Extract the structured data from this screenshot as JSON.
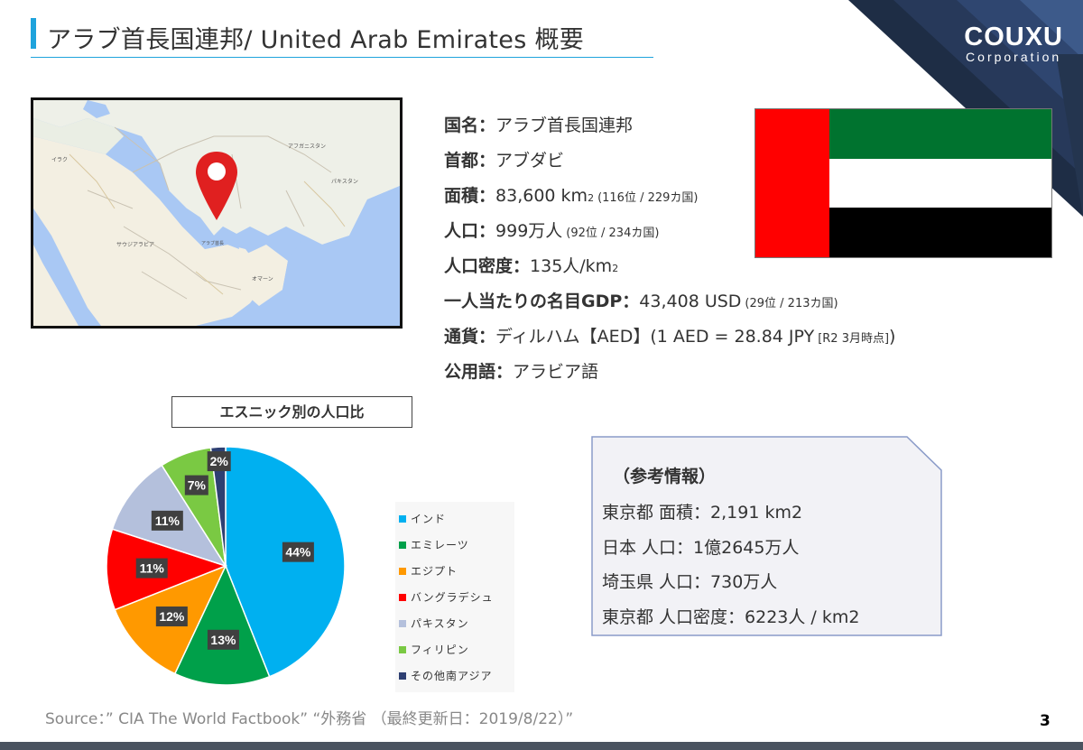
{
  "header": {
    "title": "アラブ首長国連邦/ United Arab Emirates 概要"
  },
  "logo": {
    "name": "COUXU",
    "sub": "Corporation"
  },
  "colors": {
    "accent": "#1fa3dc",
    "corner_dark": "#1e2d45"
  },
  "map": {
    "labels": [
      "アフガニスタン",
      "イラク",
      "パキスタン",
      "サウジアラビア",
      "アラブ首長国連邦",
      "オマーン"
    ],
    "marker_icon": "map-pin-icon"
  },
  "info": {
    "name_label": "国名：",
    "name_value": "アラブ首長国連邦",
    "capital_label": "首都：",
    "capital_value": "アブダビ",
    "area_label": "面積：",
    "area_value": " 83,600 km",
    "area_sup": "2",
    "area_rank": "(116位 / 229カ国)",
    "population_label": "人口：",
    "population_value": "999万人",
    "population_rank": "(92位 / 234カ国)",
    "density_label": "人口密度：",
    "density_value": "135人/km",
    "density_sup": "2",
    "gdp_label": "一人当たりの名目GDP：",
    "gdp_value": " 43,408 USD",
    "gdp_rank": "(29位 / 213カ国)",
    "currency_label": "通貨：",
    "currency_value": "ディルハム【AED】(1 AED = 28.84 JPY",
    "currency_note": "[R2 3月時点]",
    "currency_close": ")",
    "language_label": "公用語：",
    "language_value": "アラビア語"
  },
  "flag": {
    "colors": [
      "#ff0000",
      "#00732f",
      "#ffffff",
      "#000000"
    ]
  },
  "chart_title": "エスニック別の人口比",
  "chart_data": {
    "type": "pie",
    "title": "エスニック別の人口比",
    "categories": [
      "インド",
      "エミレーツ",
      "エジプト",
      "バングラデシュ",
      "パキスタン",
      "フィリピン",
      "その他南アジア"
    ],
    "values": [
      44,
      13,
      12,
      11,
      11,
      7,
      2
    ],
    "labels": [
      "44%",
      "13%",
      "12%",
      "11%",
      "11%",
      "7%",
      "2%"
    ],
    "colors": [
      "#00b0f0",
      "#00a04a",
      "#ff9900",
      "#ff0000",
      "#b4c0dc",
      "#7ac943",
      "#2e3f72"
    ],
    "legend_position": "right"
  },
  "reference": {
    "title": "（参考情報）",
    "lines": [
      "東京都 面積：2,191 km2",
      "日本 人口：1億2645万人",
      "埼玉県 人口：730万人",
      "東京都 人口密度：6223人 / km2"
    ]
  },
  "footer": {
    "source": "Source：” CIA The World Factbook” “外務省 （最終更新日：2019/8/22）”",
    "page_number": "3"
  }
}
